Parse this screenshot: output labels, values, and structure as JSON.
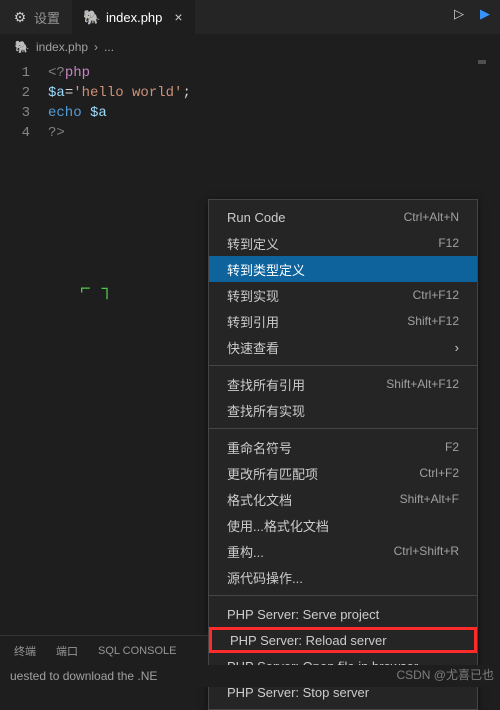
{
  "tabs": {
    "settings": "设置",
    "active_file": "index.php"
  },
  "breadcrumb": {
    "file": "index.php",
    "sep": "›",
    "ellipsis": "..."
  },
  "code": {
    "lines": [
      {
        "n": "1",
        "html": "<span class='tag'>&lt;?</span><span class='keyword'>php</span>"
      },
      {
        "n": "2",
        "html": "<span class='var'>$a</span><span class='op'>=</span><span class='string'>'hello world'</span><span class='op'>;</span>"
      },
      {
        "n": "3",
        "html": "<span class='echo'>echo</span> <span class='var'>$a</span>"
      },
      {
        "n": "4",
        "html": "<span class='tag'>?&gt;</span>"
      }
    ]
  },
  "cursor_mark": "⌐ ┐",
  "context_menu": {
    "groups": [
      [
        {
          "label": "Run Code",
          "shortcut": "Ctrl+Alt+N"
        },
        {
          "label": "转到定义",
          "shortcut": "F12"
        },
        {
          "label": "转到类型定义",
          "shortcut": "",
          "hover": true
        },
        {
          "label": "转到实现",
          "shortcut": "Ctrl+F12"
        },
        {
          "label": "转到引用",
          "shortcut": "Shift+F12"
        },
        {
          "label": "快速查看",
          "shortcut": "",
          "submenu": true
        }
      ],
      [
        {
          "label": "查找所有引用",
          "shortcut": "Shift+Alt+F12"
        },
        {
          "label": "查找所有实现",
          "shortcut": ""
        }
      ],
      [
        {
          "label": "重命名符号",
          "shortcut": "F2"
        },
        {
          "label": "更改所有匹配项",
          "shortcut": "Ctrl+F2"
        },
        {
          "label": "格式化文档",
          "shortcut": "Shift+Alt+F"
        },
        {
          "label": "使用...格式化文档",
          "shortcut": ""
        },
        {
          "label": "重构...",
          "shortcut": "Ctrl+Shift+R"
        },
        {
          "label": "源代码操作...",
          "shortcut": ""
        }
      ],
      [
        {
          "label": "PHP Server: Serve project",
          "shortcut": ""
        },
        {
          "label": "PHP Server: Reload server",
          "shortcut": "",
          "highlight": true
        },
        {
          "label": "PHP Server: Open file in browser",
          "shortcut": ""
        },
        {
          "label": "PHP Server: Stop server",
          "shortcut": ""
        }
      ]
    ]
  },
  "panel_tabs": [
    "终端",
    "端口",
    "SQL CONSOLE"
  ],
  "status_text": "uested to download the .NE",
  "watermark": "CSDN @尤喜已也",
  "icons": {
    "elephant": "🐘",
    "gear": "⚙",
    "play": "▷",
    "box": "▭",
    "chevron_right": "›"
  }
}
